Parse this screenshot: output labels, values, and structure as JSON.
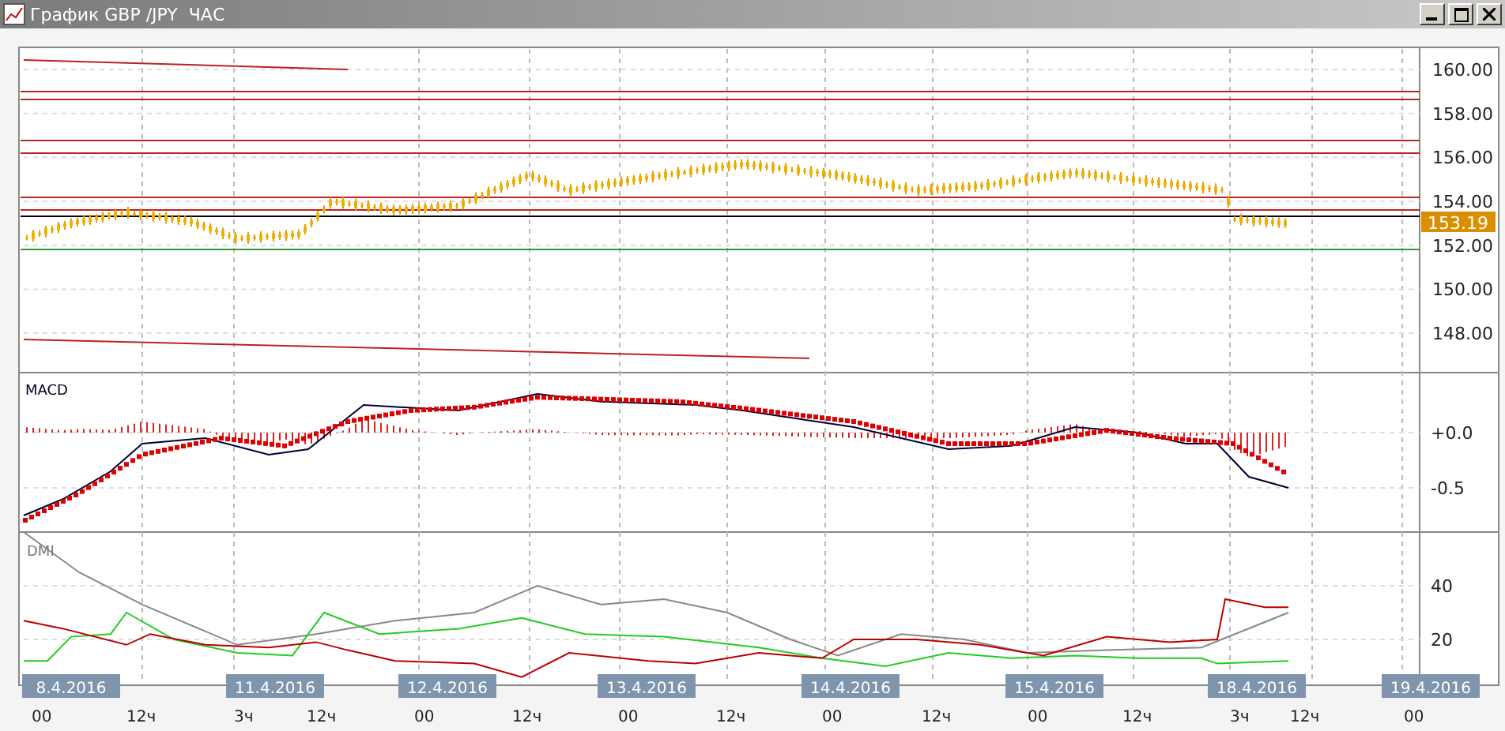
{
  "window": {
    "title": "График GBP /JPY  ЧАС"
  },
  "price_panel": {
    "axis_labels": [
      "160.00",
      "158.00",
      "156.00",
      "154.00",
      "152.00",
      "150.00",
      "148.00"
    ],
    "current_price": "153.19"
  },
  "macd_panel": {
    "title": "MACD",
    "axis_labels": [
      "+0.0",
      "-0.5"
    ]
  },
  "dmi_panel": {
    "title": "DMI",
    "axis_labels": [
      "40",
      "20"
    ]
  },
  "time_axis": {
    "dates": [
      "8.4.2016",
      "11.4.2016",
      "12.4.2016",
      "13.4.2016",
      "14.4.2016",
      "15.4.2016",
      "18.4.2016",
      "19.4.2016"
    ],
    "hours": [
      "00",
      "12ч",
      "3ч",
      "12ч",
      "00",
      "12ч",
      "00",
      "12ч",
      "00",
      "12ч",
      "00",
      "12ч",
      "3ч",
      "12ч",
      "00"
    ]
  }
}
